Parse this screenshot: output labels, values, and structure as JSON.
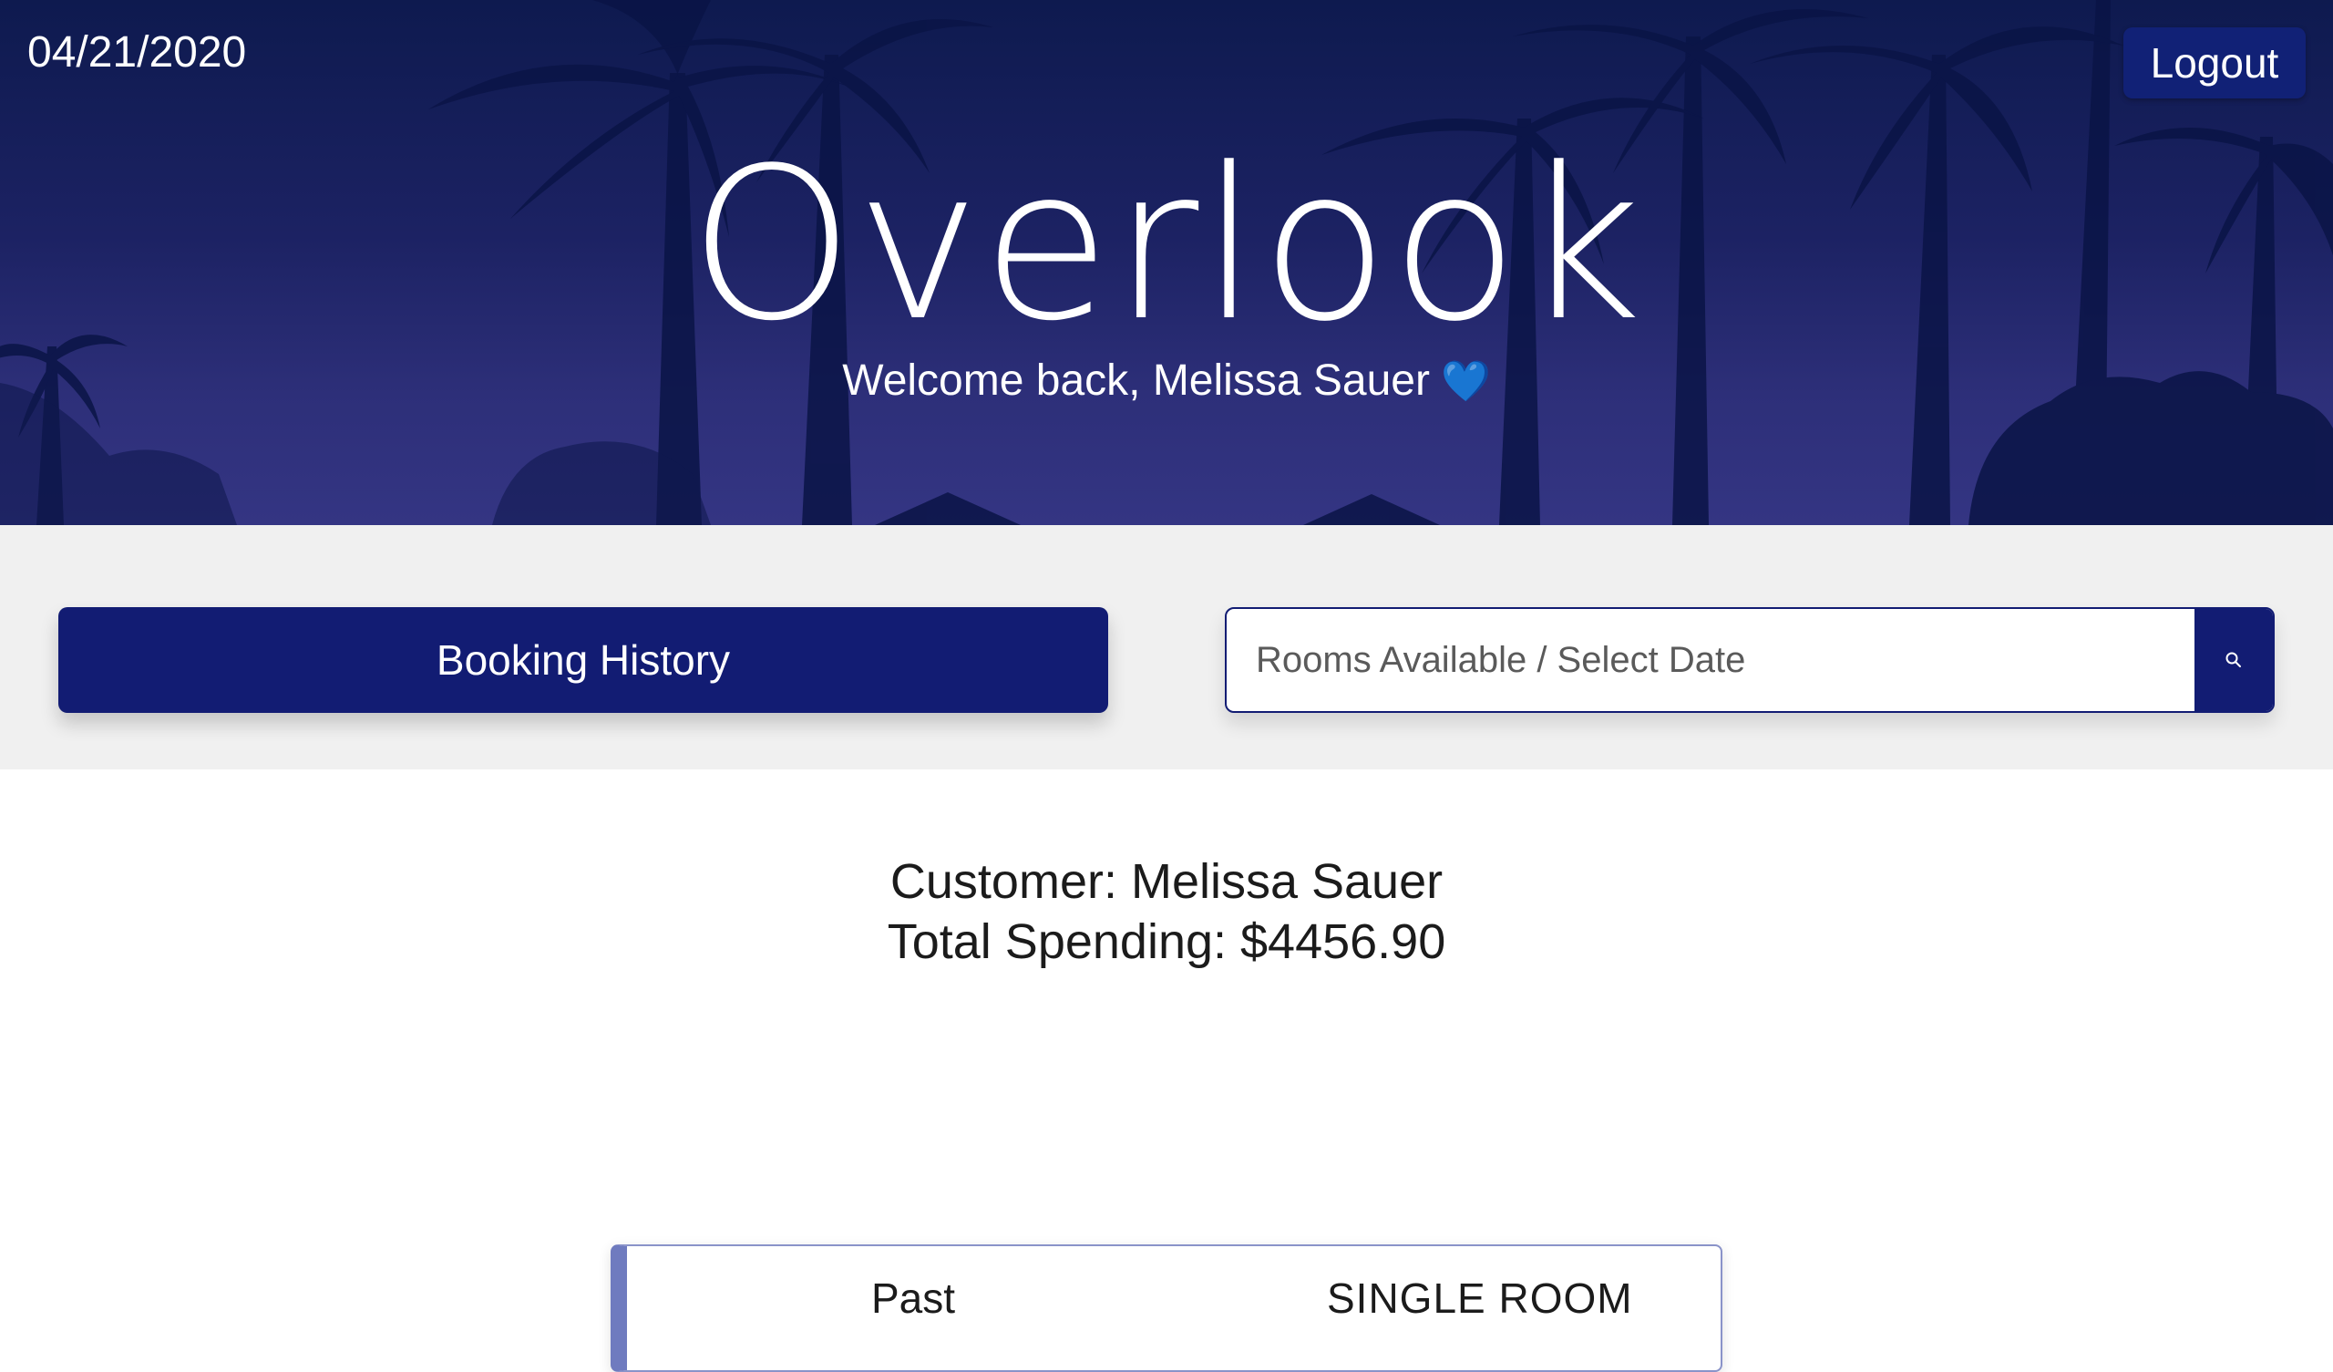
{
  "header": {
    "date": "04/21/2020",
    "logout_label": "Logout",
    "title": "Overlook",
    "welcome": "Welcome back, Melissa Sauer",
    "welcome_emoji": "💙"
  },
  "controls": {
    "booking_history_label": "Booking History",
    "search_placeholder": "Rooms Available / Select Date",
    "search_icon": "search-icon"
  },
  "customer": {
    "name_line": "Customer: Melissa Sauer",
    "spending_line": "Total Spending: $4456.90"
  },
  "bookings": [
    {
      "status": "Past",
      "room_type": "SINGLE ROOM"
    }
  ],
  "colors": {
    "primary": "#121c73",
    "card_accent": "#6f7bbf",
    "control_bg": "#f0f0f0"
  }
}
